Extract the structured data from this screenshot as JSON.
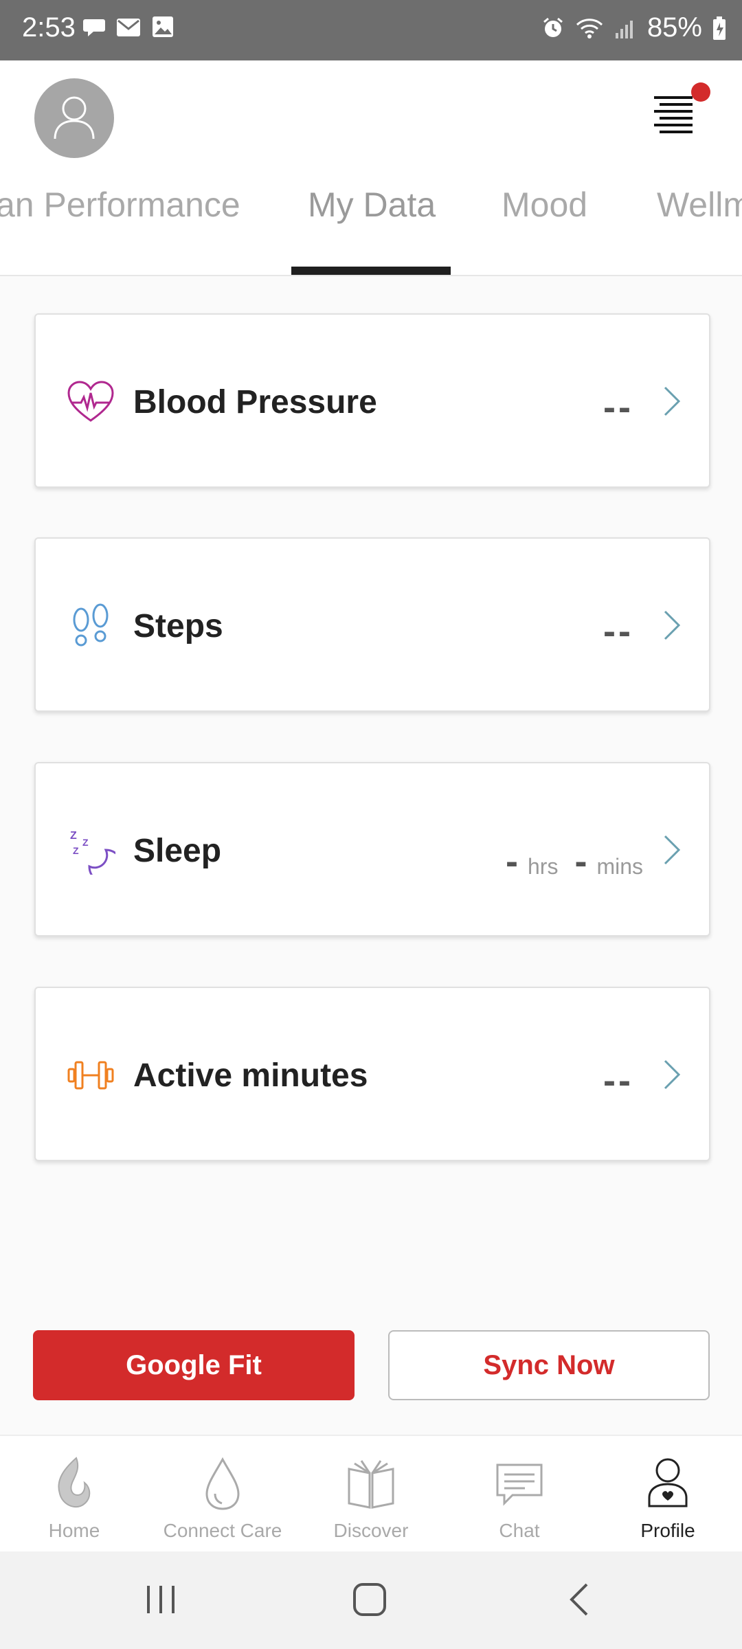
{
  "status_bar": {
    "time": "2:53",
    "battery": "85%"
  },
  "tabs": [
    {
      "label": "an Performance"
    },
    {
      "label": "My Data"
    },
    {
      "label": "Mood"
    },
    {
      "label": "Wellm"
    }
  ],
  "cards": [
    {
      "label": "Blood Pressure",
      "value": "--"
    },
    {
      "label": "Steps",
      "value": "--"
    },
    {
      "label": "Sleep",
      "hours": "-",
      "hours_unit": "hrs",
      "mins": "-",
      "mins_unit": "mins"
    },
    {
      "label": "Active minutes",
      "value": "--"
    }
  ],
  "buttons": {
    "google_fit": "Google Fit",
    "sync_now": "Sync Now"
  },
  "bottom_nav": [
    {
      "label": "Home"
    },
    {
      "label": "Connect Care"
    },
    {
      "label": "Discover"
    },
    {
      "label": "Chat"
    },
    {
      "label": "Profile"
    }
  ],
  "colors": {
    "accent": "#d32b2b",
    "status_bar": "#6e6e6e",
    "heart_icon": "#b0288f",
    "steps_icon": "#5a9bd4",
    "sleep_icon": "#7c4fc4",
    "active_icon": "#f08020"
  }
}
